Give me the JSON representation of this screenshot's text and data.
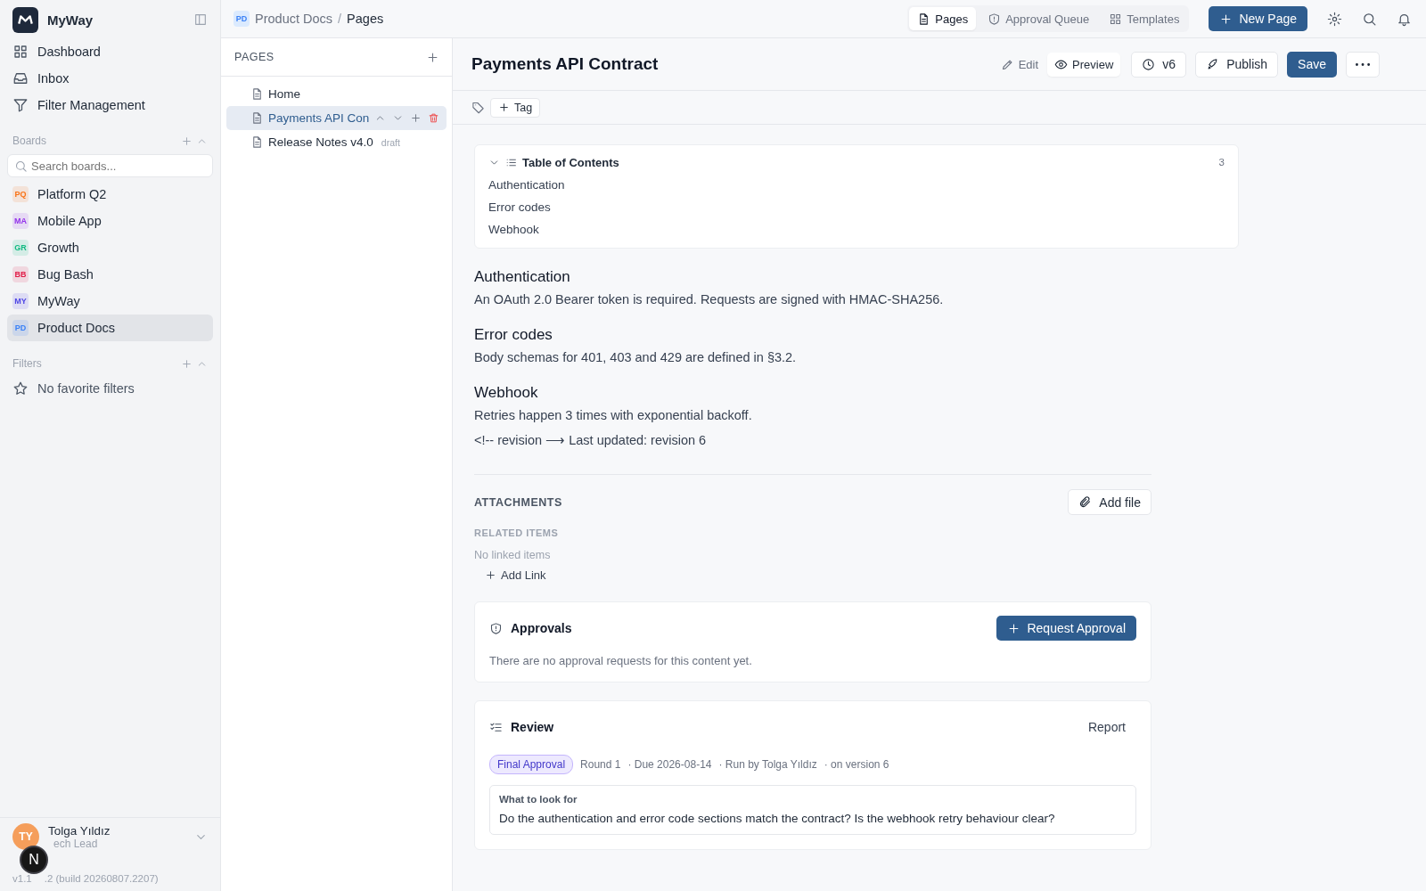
{
  "app": {
    "name": "MyWay"
  },
  "nav": [
    {
      "label": "Dashboard",
      "selected": false
    },
    {
      "label": "Inbox",
      "selected": false
    },
    {
      "label": "Filter Management",
      "selected": false
    }
  ],
  "boards": {
    "heading": "Boards",
    "search_placeholder": "Search boards...",
    "items": [
      {
        "badge": "PQ",
        "label": "Platform Q2",
        "color": "#f97316",
        "selected": false
      },
      {
        "badge": "MA",
        "label": "Mobile App",
        "color": "#9333ea",
        "selected": false
      },
      {
        "badge": "GR",
        "label": "Growth",
        "color": "#10b981",
        "selected": false
      },
      {
        "badge": "BB",
        "label": "Bug Bash",
        "color": "#e11d48",
        "selected": false
      },
      {
        "badge": "MY",
        "label": "MyWay",
        "color": "#4f46e5",
        "selected": false
      },
      {
        "badge": "PD",
        "label": "Product Docs",
        "color": "#3b82f6",
        "selected": true
      }
    ]
  },
  "filters": {
    "heading": "Filters",
    "empty": "No favorite filters"
  },
  "user": {
    "initials": "TY",
    "name": "Tolga Yıldız",
    "role": "ech Lead",
    "version_start": "v1.1",
    "version_end": ".2 (build 20260807.2207)",
    "overlay_badge": "N"
  },
  "breadcrumb": {
    "badge": "PD",
    "board": "Product Docs",
    "separator": "/",
    "page": "Pages"
  },
  "top_tabs": [
    {
      "label": "Pages",
      "selected": true
    },
    {
      "label": "Approval Queue",
      "selected": false
    },
    {
      "label": "Templates",
      "selected": false
    }
  ],
  "new_page_button": "New Page",
  "pages_panel": {
    "heading": "PAGES",
    "items": [
      {
        "title": "Home",
        "selected": false
      },
      {
        "title": "Payments API Con",
        "selected": true
      },
      {
        "title": "Release Notes v4.0",
        "badge": "draft",
        "selected": false
      }
    ]
  },
  "editor": {
    "title": "Payments API Contract",
    "modes": [
      {
        "label": "Edit",
        "selected": false
      },
      {
        "label": "Preview",
        "selected": true
      }
    ],
    "version": "v6",
    "publish": "Publish",
    "save": "Save",
    "tag_button": "Tag"
  },
  "toc": {
    "title": "Table of Contents",
    "count": "3",
    "expanded": true,
    "items": [
      "Authentication",
      "Error codes",
      "Webhook"
    ]
  },
  "sections": [
    {
      "heading": "Authentication",
      "body": "An OAuth 2.0 Bearer token is required. Requests are signed with HMAC-SHA256."
    },
    {
      "heading": "Error codes",
      "body": "Body schemas for 401, 403 and 429 are defined in §3.2."
    },
    {
      "heading": "Webhook",
      "body": "Retries happen 3 times with exponential backoff."
    }
  ],
  "comment_line": "<!-- revision ⟶ Last updated: revision 6",
  "attachments": {
    "heading": "ATTACHMENTS",
    "button": "Add file"
  },
  "related": {
    "heading": "RELATED ITEMS",
    "empty": "No linked items",
    "add_link": "Add Link"
  },
  "approvals": {
    "title": "Approvals",
    "button": "Request Approval",
    "empty": "There are no approval requests for this content yet."
  },
  "review": {
    "title": "Review",
    "report": "Report",
    "tag": "Final Approval",
    "meta": [
      "Round 1",
      "· Due 2026-08-14",
      "· Run by Tolga Yıldız",
      "· on version 6"
    ],
    "prompt_label": "What to look for",
    "prompt": "Do the authentication and error code sections match the contract? Is the webhook retry behaviour clear?"
  }
}
